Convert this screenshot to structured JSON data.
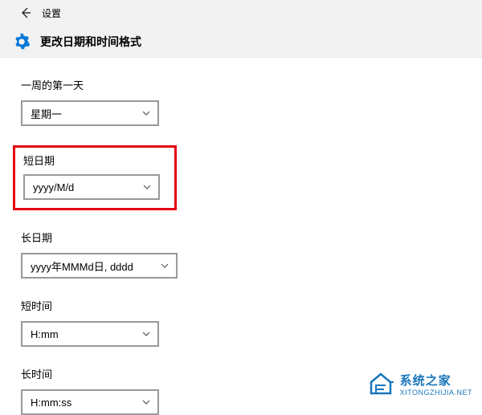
{
  "header": {
    "app_name": "设置",
    "page_title": "更改日期和时间格式"
  },
  "fields": {
    "first_day": {
      "label": "一周的第一天",
      "value": "星期一"
    },
    "short_date": {
      "label": "短日期",
      "value": "yyyy/M/d"
    },
    "long_date": {
      "label": "长日期",
      "value": "yyyy年MMMd日, dddd"
    },
    "short_time": {
      "label": "短时间",
      "value": "H:mm"
    },
    "long_time": {
      "label": "长时间",
      "value": "H:mm:ss"
    }
  },
  "watermark": {
    "title": "系统之家",
    "url": "XITONGZHIJIA.NET"
  }
}
